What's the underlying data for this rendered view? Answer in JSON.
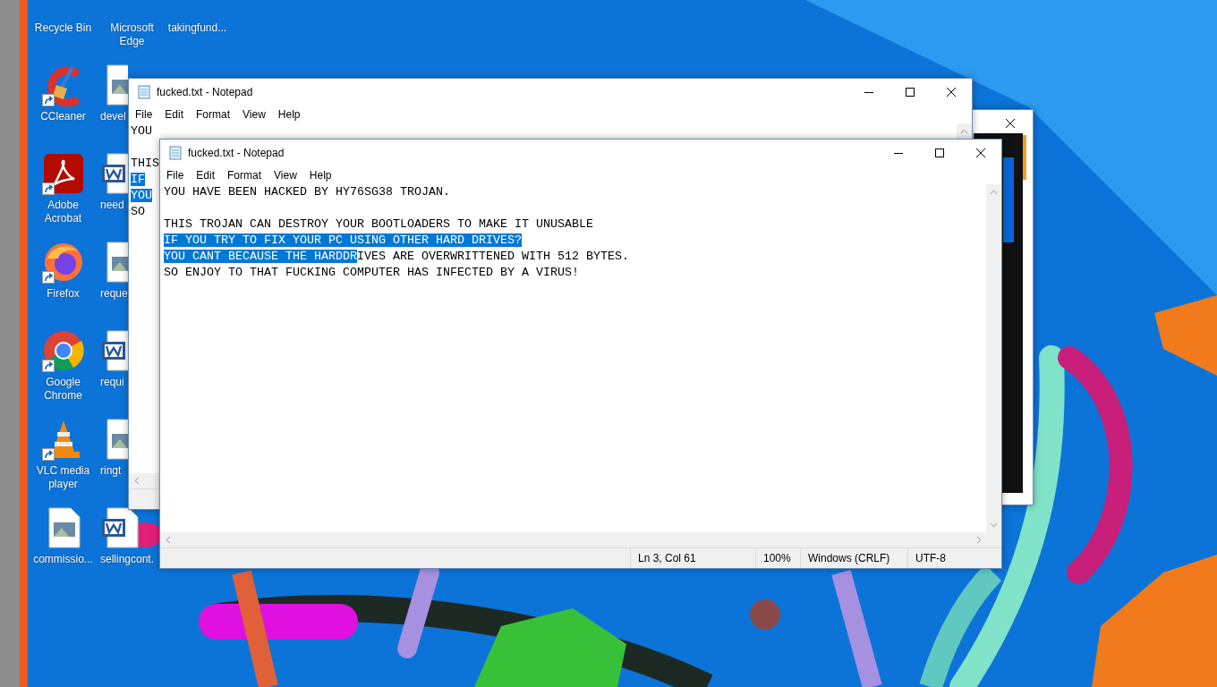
{
  "desktop_icons": [
    [
      {
        "label": "Recycle Bin"
      },
      {
        "label": "CCleaner",
        "kind": "cleaner",
        "shortcut": true
      },
      {
        "label": "Adobe Acrobat",
        "kind": "pdf",
        "shortcut": true
      },
      {
        "label": "Firefox",
        "kind": "firefox",
        "shortcut": true
      },
      {
        "label": "Google Chrome",
        "kind": "chrome",
        "shortcut": true
      },
      {
        "label": "VLC media player",
        "kind": "cone",
        "shortcut": true
      },
      {
        "label": "commissio...",
        "kind": "image"
      }
    ],
    [
      {
        "label": "Microsoft Edge"
      },
      {
        "label": "devel",
        "kind": "image"
      },
      {
        "label": "need",
        "kind": "word"
      },
      {
        "label": "reque",
        "kind": "image"
      },
      {
        "label": "requi",
        "kind": "word"
      },
      {
        "label": "ringt",
        "kind": "image"
      },
      {
        "label": "sellingcont.",
        "kind": "word"
      }
    ],
    [
      {
        "label": "takingfund..."
      }
    ]
  ],
  "windows": [
    {
      "kind": "partial"
    },
    {
      "kind": "notepad",
      "title": "fucked.txt - Notepad",
      "menu": [
        "File",
        "Edit",
        "Format",
        "View",
        "Help"
      ],
      "lines": [
        {
          "segments": [
            {
              "text": "YOU",
              "selected": false
            }
          ]
        },
        {
          "blank": true
        },
        {
          "segments": [
            {
              "text": "THIS",
              "selected": false
            }
          ]
        },
        {
          "segments": [
            {
              "text": "IF",
              "selected": true
            }
          ]
        },
        {
          "segments": [
            {
              "text": "YOU",
              "selected": true
            }
          ]
        },
        {
          "segments": [
            {
              "text": "SO",
              "selected": false
            }
          ]
        }
      ]
    },
    {
      "kind": "notepad",
      "title": "fucked.txt - Notepad",
      "menu": [
        "File",
        "Edit",
        "Format",
        "View",
        "Help"
      ],
      "lines": [
        {
          "segments": [
            {
              "text": "YOU HAVE BEEN HACKED BY HY76SG38 TROJAN.",
              "selected": false
            }
          ]
        },
        {
          "blank": true
        },
        {
          "segments": [
            {
              "text": "THIS TROJAN CAN DESTROY YOUR BOOTLOADERS TO MAKE IT UNUSABLE",
              "selected": false
            }
          ]
        },
        {
          "segments": [
            {
              "text": "IF YOU TRY TO FIX YOUR PC USING OTHER HARD DRIVES?",
              "selected": true
            }
          ]
        },
        {
          "segments": [
            {
              "text": "YOU CANT BECAUSE THE HARDDR",
              "selected": true
            },
            {
              "text": "IVES ARE OVERWRITTENED WITH 512 BYTES.",
              "selected": false
            }
          ]
        },
        {
          "segments": [
            {
              "text": "SO ENJOY TO THAT FUCKING COMPUTER HAS INFECTED BY A VIRUS!",
              "selected": false
            }
          ]
        }
      ],
      "status_bar": [
        "Ln 3, Col 61",
        "100%",
        "Windows (CRLF)",
        "UTF-8"
      ]
    }
  ]
}
